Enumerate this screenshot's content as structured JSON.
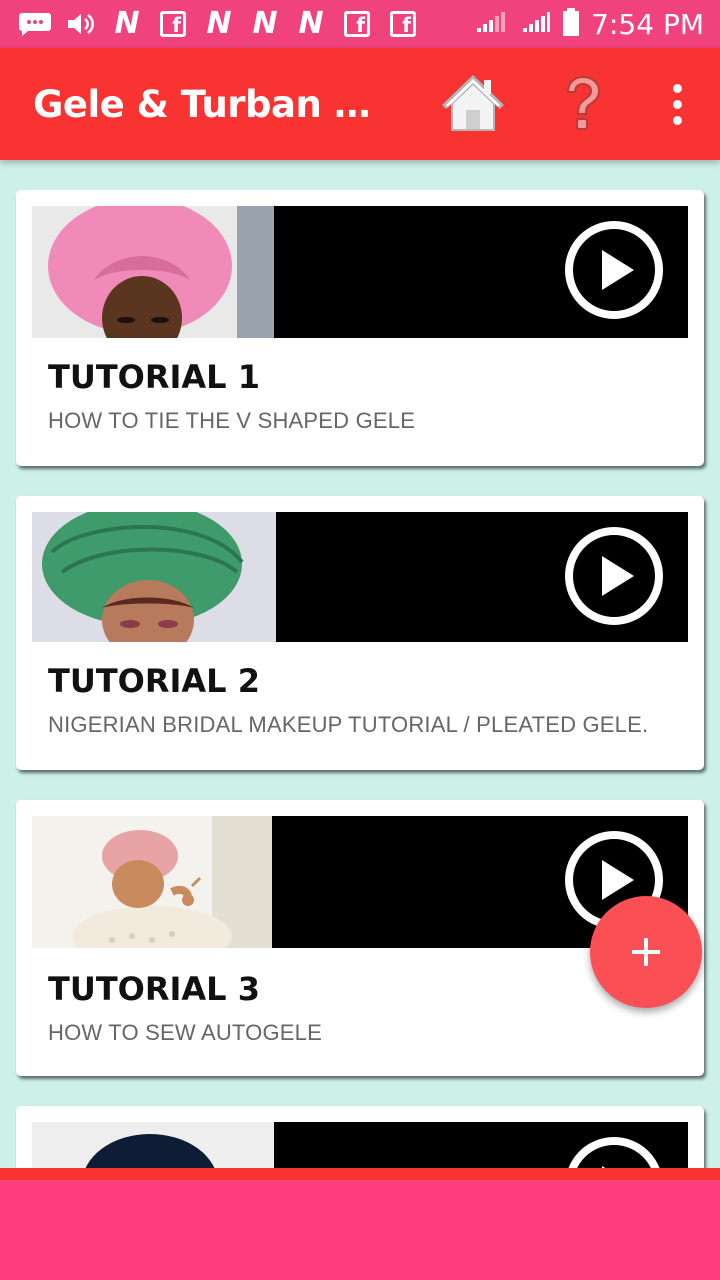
{
  "status_bar": {
    "time": "7:54 PM",
    "notification_letters": [
      "N",
      "f",
      "N",
      "N",
      "N",
      "f",
      "f"
    ]
  },
  "app_bar": {
    "title": "Gele & Turban Tut...",
    "icons": [
      "home-icon",
      "help-question-icon",
      "more-vert-icon"
    ]
  },
  "tutorials": [
    {
      "title": "TUTORIAL 1",
      "subtitle": "HOW TO TIE THE V SHAPED GELE",
      "headwrap_color": "#f08ab8",
      "photo_bg": "#e9e9ea"
    },
    {
      "title": "TUTORIAL 2",
      "subtitle": "NIGERIAN BRIDAL MAKEUP TUTORIAL / PLEATED GELE.",
      "headwrap_color": "#3f9a6c",
      "photo_bg": "#dcdde6"
    },
    {
      "title": "TUTORIAL 3",
      "subtitle": "HOW TO SEW AUTOGELE",
      "headwrap_color": "#e8a3a6",
      "photo_bg": "#f4f2ec"
    },
    {
      "title": "",
      "subtitle": "",
      "headwrap_color": "#0e1c35",
      "photo_bg": "#eeeeee"
    }
  ],
  "fab": {
    "label": "+"
  },
  "colors": {
    "status_bar": "#f0427c",
    "app_bar": "#f93232",
    "background": "#cdf0e8",
    "fab": "#fa4f55",
    "bottom_bar": "#ff3c7d"
  }
}
